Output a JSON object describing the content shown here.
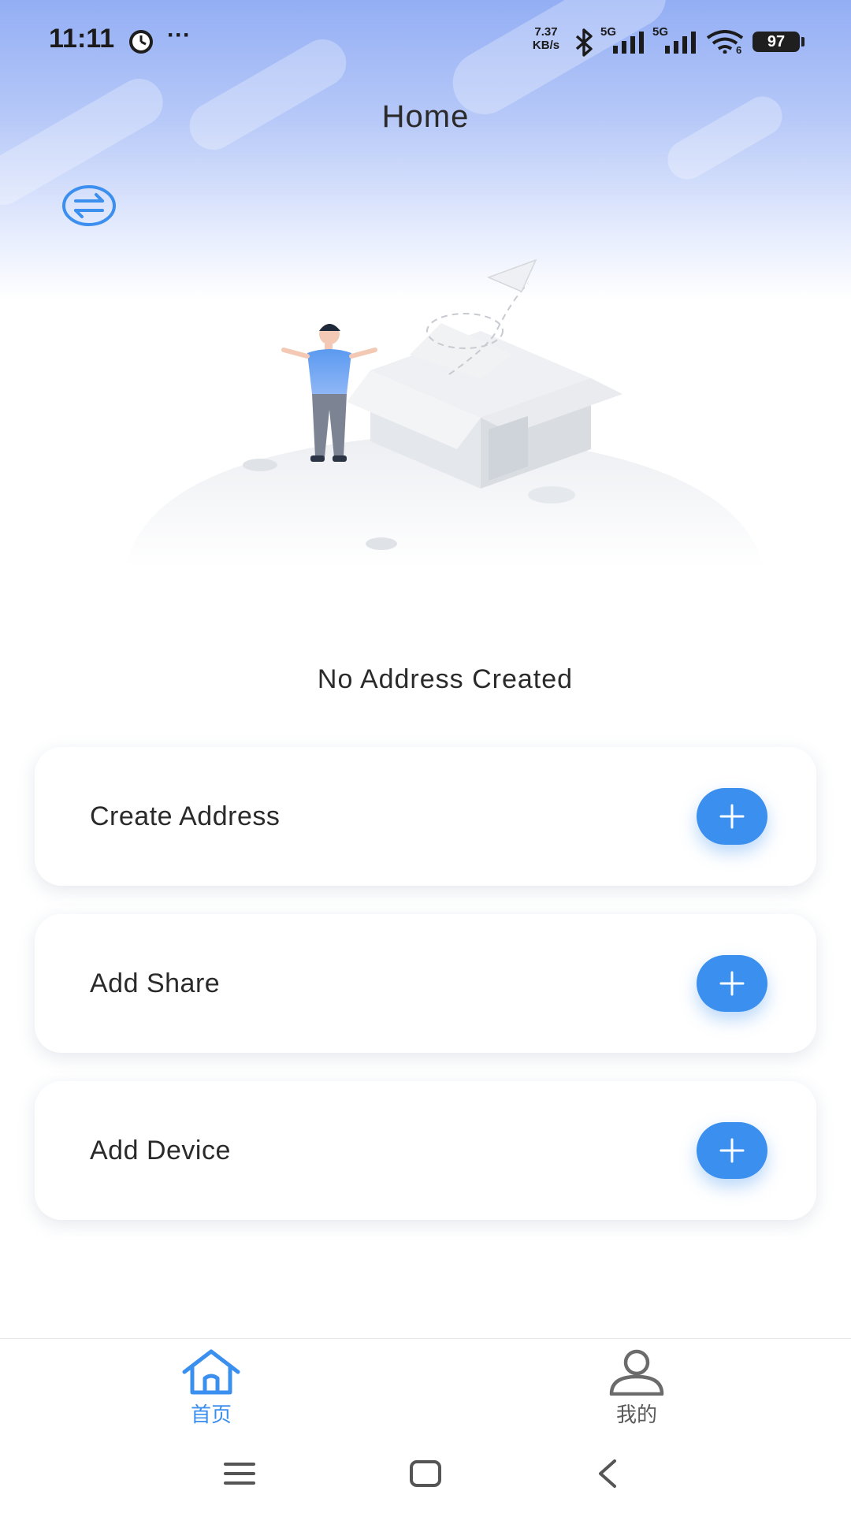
{
  "status_bar": {
    "time": "11:11",
    "net_speed_value": "7.37",
    "net_speed_unit": "KB/s",
    "signal_1_label": "5G",
    "signal_2_label": "5G",
    "wifi_label": "6",
    "battery": "97",
    "more": "···"
  },
  "header": {
    "title": "Home"
  },
  "empty_state": {
    "message": "No Address Created"
  },
  "actions": [
    {
      "label": "Create Address"
    },
    {
      "label": "Add Share"
    },
    {
      "label": "Add Device"
    }
  ],
  "bottom_nav": {
    "items": [
      {
        "label": "首页",
        "icon": "home-icon",
        "active": true
      },
      {
        "label": "我的",
        "icon": "person-icon",
        "active": false
      }
    ]
  },
  "colors": {
    "accent": "#3b8fee",
    "active_nav": "#3b8fee",
    "inactive_nav": "#5a5a5a"
  }
}
